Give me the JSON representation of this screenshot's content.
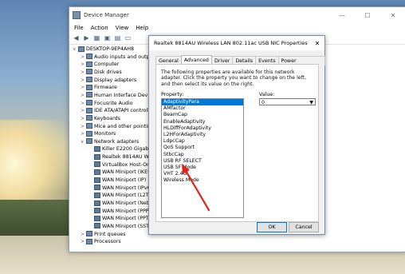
{
  "device_manager": {
    "title": "Device Manager",
    "menu": [
      "File",
      "Action",
      "View",
      "Help"
    ],
    "controls": {
      "minimize": "—",
      "maximize": "☐",
      "close": "✕"
    },
    "tree": [
      {
        "label": "DESKTOP-9EP4AH8",
        "level": 0,
        "exp": "∨"
      },
      {
        "label": "Audio inputs and outpu",
        "level": 1,
        "exp": ">"
      },
      {
        "label": "Computer",
        "level": 1,
        "exp": ">"
      },
      {
        "label": "Disk drives",
        "level": 1,
        "exp": ">"
      },
      {
        "label": "Display adapters",
        "level": 1,
        "exp": ">"
      },
      {
        "label": "Firmware",
        "level": 1,
        "exp": ">"
      },
      {
        "label": "Human Interface Device",
        "level": 1,
        "exp": ">"
      },
      {
        "label": "Focusrite Audio",
        "level": 1,
        "exp": ">"
      },
      {
        "label": "IDE ATA/ATAPI controlle",
        "level": 1,
        "exp": ">"
      },
      {
        "label": "Keyboards",
        "level": 1,
        "exp": ">"
      },
      {
        "label": "Mice and other pointing",
        "level": 1,
        "exp": ">"
      },
      {
        "label": "Monitors",
        "level": 1,
        "exp": ">"
      },
      {
        "label": "Network adapters",
        "level": 1,
        "exp": "∨"
      },
      {
        "label": "Killer E2200 Gigabit E",
        "level": 2,
        "exp": ""
      },
      {
        "label": "Realtek 8814AU Wire",
        "level": 2,
        "exp": ""
      },
      {
        "label": "VirtualBox Host-Onl",
        "level": 2,
        "exp": ""
      },
      {
        "label": "WAN Miniport (IKEv",
        "level": 2,
        "exp": ""
      },
      {
        "label": "WAN Miniport (IP)",
        "level": 2,
        "exp": ""
      },
      {
        "label": "WAN Miniport (IPv6",
        "level": 2,
        "exp": ""
      },
      {
        "label": "WAN Miniport (L2TF",
        "level": 2,
        "exp": ""
      },
      {
        "label": "WAN Miniport (Netv",
        "level": 2,
        "exp": ""
      },
      {
        "label": "WAN Miniport (PPP",
        "level": 2,
        "exp": ""
      },
      {
        "label": "WAN Miniport (PPT",
        "level": 2,
        "exp": ""
      },
      {
        "label": "WAN Miniport (SSTI",
        "level": 2,
        "exp": ""
      },
      {
        "label": "Print queues",
        "level": 1,
        "exp": ">"
      },
      {
        "label": "Processors",
        "level": 1,
        "exp": ">"
      }
    ]
  },
  "dialog": {
    "title": "Realtek 8814AU Wireless LAN 802.11ac USB NIC Properties",
    "close": "✕",
    "tabs": [
      "General",
      "Advanced",
      "Driver",
      "Details",
      "Events",
      "Power Management"
    ],
    "active_tab": "Advanced",
    "description": "The following properties are available for this network adapter. Click the property you want to change on the left, and then select its value on the right.",
    "property_label": "Property:",
    "value_label": "Value:",
    "properties": [
      "AdaptivityPara",
      "AMfactor",
      "BeamCap",
      "EnableAdaptivity",
      "HLDiffForAdaptivity",
      "L2HForAdaptivity",
      "LdpcCap",
      "QoS Support",
      "StbcCap",
      "USB RF SELECT",
      "USB SF Mode",
      "VHT 2.4G",
      "Wireless Mode"
    ],
    "selected_property": "AdaptivityPara",
    "value": "0",
    "ok_label": "OK",
    "cancel_label": "Cancel"
  },
  "colors": {
    "selection": "#0078d7",
    "annotation_arrow": "#e0231b"
  }
}
